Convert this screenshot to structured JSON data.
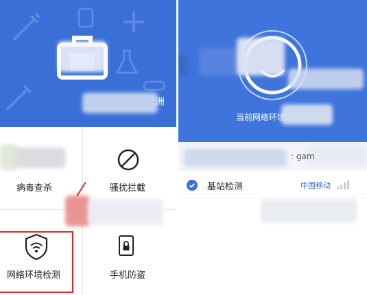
{
  "left_panel": {
    "features": {
      "antivirus": "病毒查杀",
      "harassment_block": "骚扰拦截",
      "network_check": "网络环境检测",
      "anti_theft": "手机防盗"
    },
    "header_partial_glyph": "洲"
  },
  "right_panel": {
    "status_text": "当前网络环境",
    "account_suffix": ": gam",
    "rows": [
      {
        "label": "基站检测",
        "carrier": "中国移动"
      }
    ]
  },
  "colors": {
    "primary_blue": "#3a6fd8",
    "highlight_red": "#e02424",
    "carrier_blue": "#3b6fd6"
  }
}
